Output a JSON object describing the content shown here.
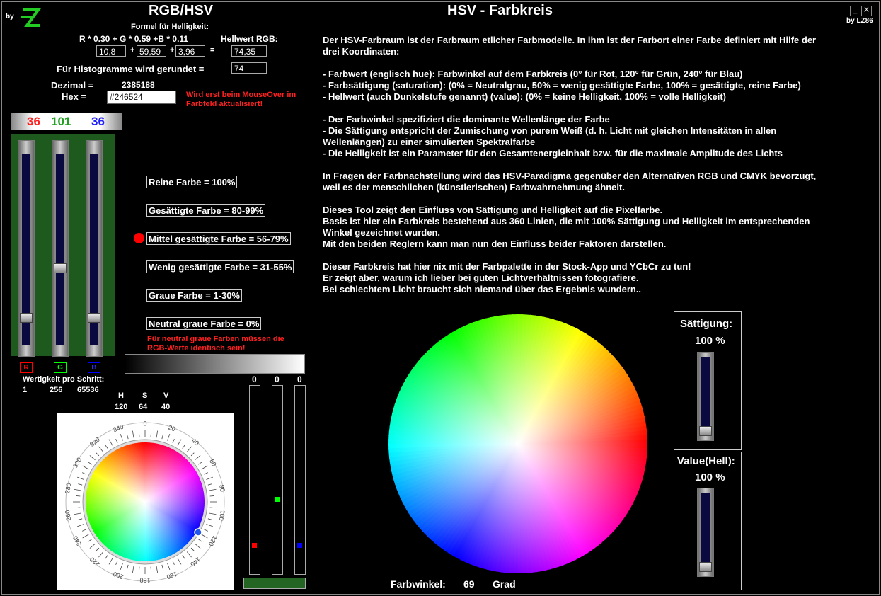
{
  "header": {
    "by_label": "by",
    "logo_text": "ZL",
    "left_title": "RGB/HSV",
    "main_title": "HSV - Farbkreis",
    "credit": "by LZ86",
    "minimize_label": "_",
    "close_label": "X"
  },
  "formula": {
    "heading": "Formel für Helligkeit:",
    "expr": "R * 0.30  +  G * 0.59  +B  * 0.11",
    "helper_label": "Hellwert RGB:",
    "r_part": "10,8",
    "g_part": "59,59",
    "b_part": "3,96",
    "plus1": "+",
    "plus2": "+",
    "equals": "=",
    "hellwert": "74,35"
  },
  "histogram": {
    "label": "Für Histogramme wird gerundet =",
    "value": "74"
  },
  "values": {
    "dezimal_label": "Dezimal =",
    "dezimal_value": "2385188",
    "hex_label": "Hex =",
    "hex_value": "#246524",
    "mouseover_note": "Wird erst beim MouseOver im Farbfeld aktualisiert!"
  },
  "rgb": {
    "r": "36",
    "g": "101",
    "b": "36",
    "r_label": "R",
    "g_label": "G",
    "b_label": "B",
    "r_level": 0.14,
    "g_level": 0.4,
    "b_level": 0.14,
    "wertigkeit_label": "Wertigkeit pro Schritt:",
    "wertigkeit": [
      "1",
      "256",
      "65536"
    ]
  },
  "saturation_levels": [
    {
      "label": "Reine Farbe = 100%",
      "active": false
    },
    {
      "label": "Gesättigte Farbe =  80-99%",
      "active": false
    },
    {
      "label": "Mittel gesättigte Farbe = 56-79%",
      "active": true
    },
    {
      "label": "Wenig gesättigte Farbe = 31-55%",
      "active": false
    },
    {
      "label": "Graue Farbe = 1-30%",
      "active": false
    },
    {
      "label": "Neutral graue Farbe = 0%",
      "active": false
    }
  ],
  "neutral_note": "Für neutral graue Farben müssen die RGB-Werte identisch sein!",
  "hsv": {
    "h_label": "H",
    "s_label": "S",
    "v_label": "V",
    "h": "120",
    "s": "64",
    "v": "40"
  },
  "dial_ticks": [
    "0",
    "20",
    "40",
    "60",
    "80",
    "100",
    "120",
    "140",
    "160",
    "180",
    "200",
    "220",
    "240",
    "260",
    "280",
    "300",
    "320",
    "340"
  ],
  "mini_sliders": {
    "values": [
      "0",
      "0",
      "0"
    ],
    "marker_colors": [
      "#ff0000",
      "#00ff00",
      "#0000ff"
    ]
  },
  "description": [
    "Der HSV-Farbraum ist der Farbraum etlicher Farbmodelle. In ihm ist der Farbort einer Farbe definiert mit Hilfe der drei Koordinaten:",
    "- Farbwert (englisch hue): Farbwinkel auf dem Farbkreis (0° für Rot, 120° für Grün, 240° für Blau)\n- Farbsättigung (saturation): (0% = Neutralgrau, 50% = wenig gesättigte Farbe, 100% = gesättigte, reine Farbe)\n- Hellwert (auch Dunkelstufe genannt) (value): (0% = keine Helligkeit, 100% = volle Helligkeit)",
    "- Der Farbwinkel spezifiziert die dominante Wellenlänge der Farbe\n- Die Sättigung entspricht der Zumischung von purem Weiß (d. h. Licht mit gleichen Intensitäten in allen Wellenlängen) zu einer simulierten Spektralfarbe\n- Die Helligkeit ist ein Parameter für den Gesamtenergieinhalt bzw. für die maximale Amplitude des Lichts",
    "In Fragen der Farbnachstellung wird das HSV-Paradigma gegenüber den Alternativen RGB und CMYK bevorzugt, weil es der menschlichen (künstlerischen) Farbwahrnehmung ähnelt.",
    "Dieses Tool zeigt den Einfluss von Sättigung und Helligkeit auf die Pixelfarbe.\nBasis ist hier ein Farbkreis bestehend aus 360 Linien, die mit 100% Sättigung und Helligkeit im entsprechenden Winkel gezeichnet wurden.\nMit den beiden Reglern kann man nun den Einfluss beider Faktoren darstellen.",
    "Dieser Farbkreis hat hier nix mit der Farbpalette in der Stock-App und YCbCr zu tun!\nEr zeigt aber, warum ich lieber bei guten Lichtverhältnissen fotografiere.\nBei schlechtem Licht braucht sich  niemand über das Ergebnis wundern.."
  ],
  "farbwinkel": {
    "label": "Farbwinkel:",
    "value": "69",
    "unit": "Grad"
  },
  "controls": {
    "saettigung_label": "Sättigung:",
    "saettigung_value": "100 %",
    "value_label": "Value(Hell):",
    "value_value": "100 %"
  }
}
